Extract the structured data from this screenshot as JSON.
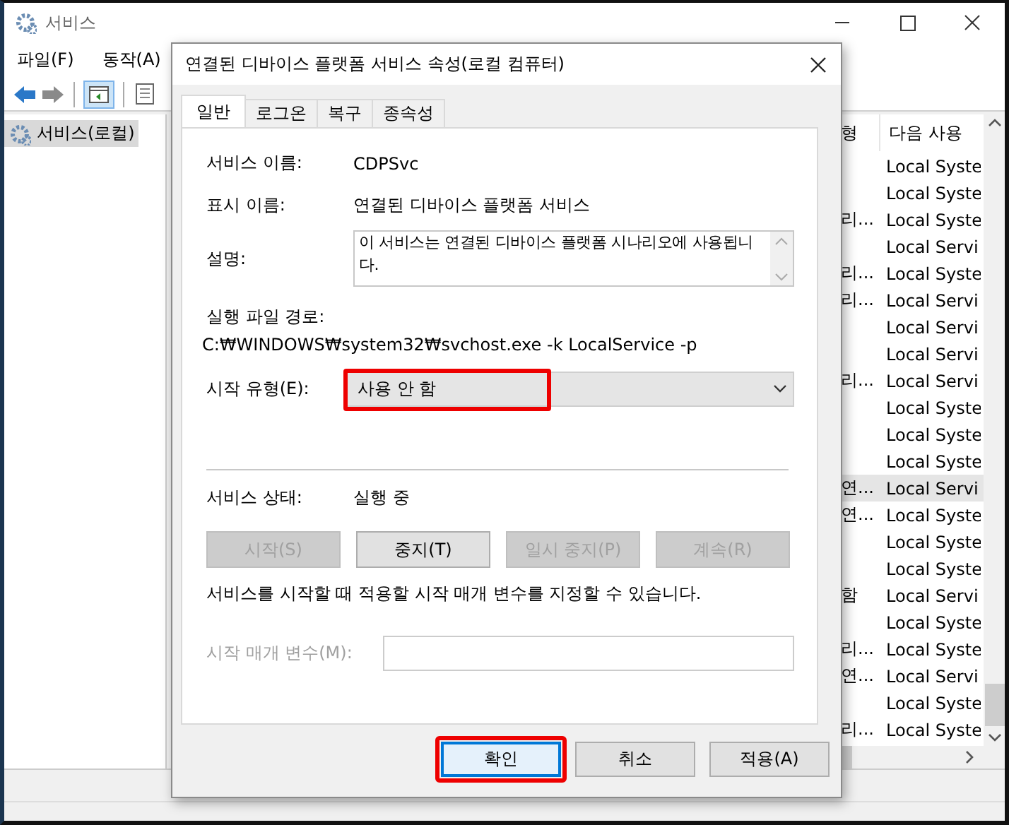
{
  "window": {
    "title": "서비스",
    "menu": [
      "파일(F)",
      "동작(A)"
    ]
  },
  "tree": {
    "items": [
      {
        "label": "서비스(로컬)",
        "selected": true
      }
    ]
  },
  "list": {
    "columns": [
      "형",
      "다음 사용"
    ],
    "rows": [
      {
        "column_2": "Local Syste",
        "selected": false
      },
      {
        "column_2": "Local Syste",
        "selected": false
      },
      {
        "column_1": "리...",
        "column_2": "Local Syste",
        "selected": false
      },
      {
        "column_2": "Local Servi",
        "selected": false
      },
      {
        "column_1": "리...",
        "column_2": "Local Syste",
        "selected": false
      },
      {
        "column_1": "리...",
        "column_2": "Local Servi",
        "selected": false
      },
      {
        "column_2": "Local Servi",
        "selected": false
      },
      {
        "column_2": "Local Servi",
        "selected": false
      },
      {
        "column_1": "리...",
        "column_2": "Local Servi",
        "selected": false
      },
      {
        "column_2": "Local Syste",
        "selected": false
      },
      {
        "column_2": "Local Syste",
        "selected": false
      },
      {
        "column_2": "Local Syste",
        "selected": false
      },
      {
        "column_1": "연...",
        "column_2": "Local Servi",
        "selected": true
      },
      {
        "column_1": "연...",
        "column_2": "Local Syste",
        "selected": false
      },
      {
        "column_2": "Local Syste",
        "selected": false
      },
      {
        "column_2": "Local Syste",
        "selected": false
      },
      {
        "column_1": "함",
        "column_2": "Local Servi",
        "selected": false
      },
      {
        "column_2": "Local Syste",
        "selected": false
      },
      {
        "column_1": "리...",
        "column_2": "Local Syste",
        "selected": false
      },
      {
        "column_1": "연...",
        "column_2": "Local Servi",
        "selected": false
      },
      {
        "column_2": "Local Syste",
        "selected": false
      },
      {
        "column_1": "리...",
        "column_2": "Local Syste",
        "selected": false
      }
    ]
  },
  "dialog": {
    "title": "연결된 디바이스 플랫폼 서비스 속성(로컬 컴퓨터)",
    "tabs": [
      {
        "label": "일반",
        "selected": true
      },
      {
        "label": "로그온",
        "selected": false
      },
      {
        "label": "복구",
        "selected": false
      },
      {
        "label": "종속성",
        "selected": false
      }
    ],
    "fields": [
      {
        "label": "서비스 이름:",
        "value": "CDPSvc"
      },
      {
        "label": "표시 이름:",
        "value": "연결된 디바이스 플랫폼 서비스"
      }
    ],
    "description": {
      "label": "설명:",
      "value": "이 서비스는 연결된 디바이스 플랫폼 시나리오에 사용됩니다."
    },
    "path": {
      "label": "실행 파일 경로:",
      "value": "C:₩WINDOWS₩system32₩svchost.exe -k LocalService -p"
    },
    "startup": {
      "label": "시작 유형(E):",
      "value": "사용 안 함",
      "highlighted": true
    },
    "status": {
      "label": "서비스 상태:",
      "value": "실행 중"
    },
    "control_buttons": [
      {
        "label": "시작(S)",
        "disabled": true
      },
      {
        "label": "중지(T)",
        "disabled": false
      },
      {
        "label": "일시 중지(P)",
        "disabled": true
      },
      {
        "label": "계속(R)",
        "disabled": true
      }
    ],
    "note": "서비스를 시작할 때 적용할 시작 매개 변수를 지정할 수 있습니다.",
    "parameters": {
      "label": "시작 매개 변수(M):",
      "disabled": true
    },
    "buttons": [
      {
        "label": "확인",
        "default": true,
        "highlighted": true
      },
      {
        "label": "취소",
        "default": false,
        "highlighted": false
      },
      {
        "label": "적용(A)",
        "default": false,
        "highlighted": false
      }
    ]
  }
}
